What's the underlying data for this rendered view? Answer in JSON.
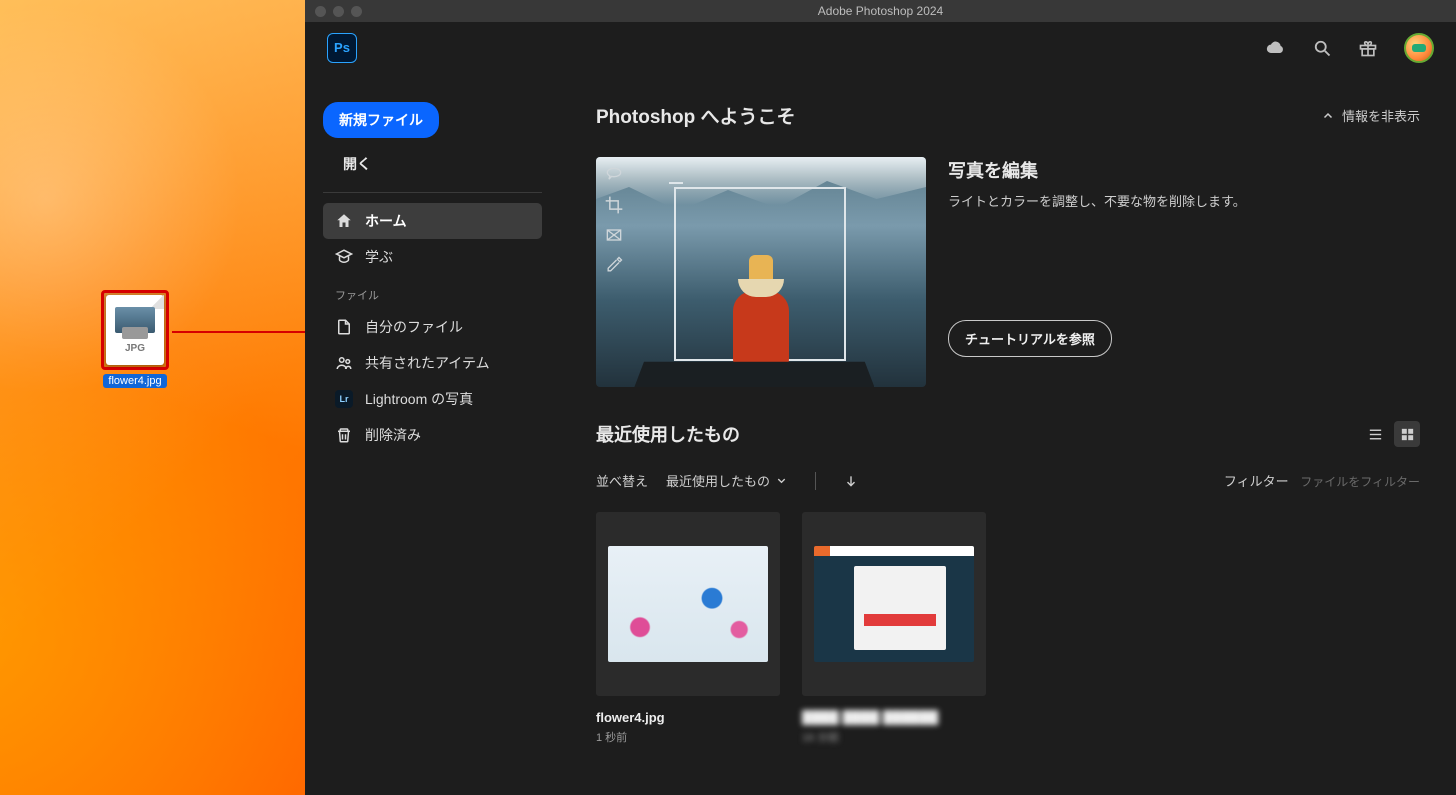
{
  "window": {
    "title": "Adobe Photoshop 2024"
  },
  "desktop_file": {
    "name": "flower4.jpg",
    "ext": "JPG"
  },
  "logo": "Ps",
  "sidebar": {
    "new_button": "新規ファイル",
    "open": "開く",
    "nav": {
      "home": "ホーム",
      "learn": "学ぶ"
    },
    "section_file": "ファイル",
    "items": {
      "my_files": "自分のファイル",
      "shared": "共有されたアイテム",
      "lightroom": "Lightroom の写真",
      "deleted": "削除済み"
    },
    "lr_badge": "Lr"
  },
  "welcome": {
    "title": "Photoshop へようこそ",
    "hide": "情報を非表示"
  },
  "hero": {
    "title": "写真を編集",
    "desc": "ライトとカラーを調整し、不要な物を削除します。",
    "cta": "チュートリアルを参照"
  },
  "recent": {
    "title": "最近使用したもの",
    "sort_label": "並べ替え",
    "sort_value": "最近使用したもの",
    "filter_label": "フィルター",
    "filter_placeholder": "ファイルをフィルター",
    "items": [
      {
        "name": "flower4.jpg",
        "time": "1 秒前"
      },
      {
        "name": "████ ████ ██████",
        "time": "16 分前"
      }
    ]
  }
}
